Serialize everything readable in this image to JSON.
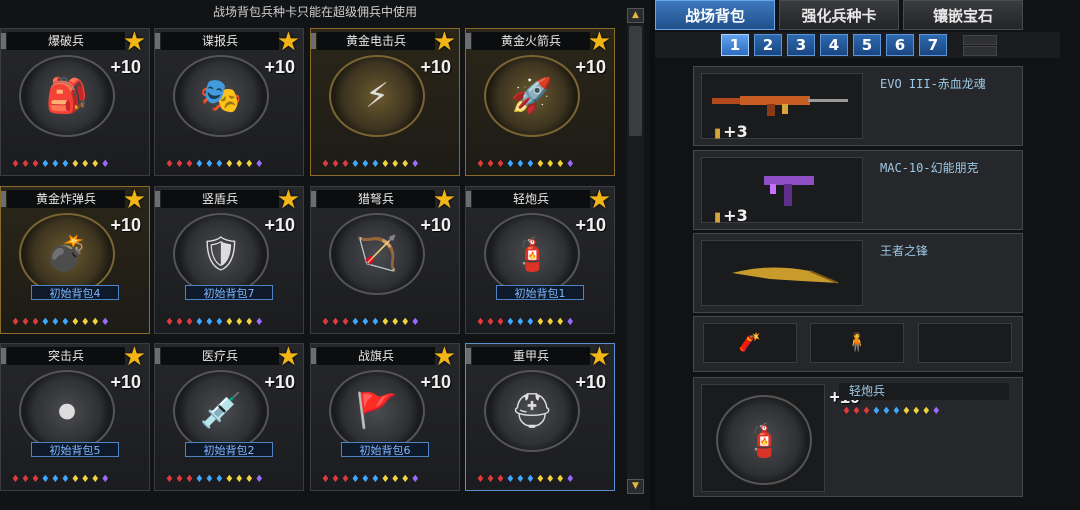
{
  "notice": "战场背包兵种卡只能在超级佣兵中使用",
  "cards": [
    {
      "name": "爆破兵",
      "bonus": "+10",
      "icon": "demolition-kit-icon",
      "glyph": "🎒",
      "gold": false,
      "pack": ""
    },
    {
      "name": "谍报兵",
      "bonus": "+10",
      "icon": "spy-mask-icon",
      "glyph": "🎭",
      "gold": false,
      "pack": ""
    },
    {
      "name": "黄金电击兵",
      "bonus": "+10",
      "icon": "golden-shock-icon",
      "glyph": "⚡",
      "gold": true,
      "pack": ""
    },
    {
      "name": "黄金火箭兵",
      "bonus": "+10",
      "icon": "golden-rocket-icon",
      "glyph": "🚀",
      "gold": true,
      "pack": ""
    },
    {
      "name": "黄金炸弹兵",
      "bonus": "+10",
      "icon": "golden-bomb-icon",
      "glyph": "💣",
      "gold": true,
      "pack": "初始背包4"
    },
    {
      "name": "竖盾兵",
      "bonus": "+10",
      "icon": "riot-shield-icon",
      "glyph": "🛡",
      "gold": false,
      "pack": "初始背包7"
    },
    {
      "name": "猎弩兵",
      "bonus": "+10",
      "icon": "crossbow-icon",
      "glyph": "🏹",
      "gold": false,
      "pack": ""
    },
    {
      "name": "轻炮兵",
      "bonus": "+10",
      "icon": "mortar-icon",
      "glyph": "🧯",
      "gold": false,
      "pack": "初始背包1"
    },
    {
      "name": "突击兵",
      "bonus": "+10",
      "icon": "assault-device-icon",
      "glyph": "⏺",
      "gold": false,
      "pack": "初始背包5"
    },
    {
      "name": "医疗兵",
      "bonus": "+10",
      "icon": "medic-kit-icon",
      "glyph": "💉",
      "gold": false,
      "pack": "初始背包2"
    },
    {
      "name": "战旗兵",
      "bonus": "+10",
      "icon": "war-banner-icon",
      "glyph": "🚩",
      "gold": false,
      "pack": "初始背包6"
    },
    {
      "name": "重甲兵",
      "bonus": "+10",
      "icon": "heavy-armor-helmet-icon",
      "glyph": "⛑",
      "gold": false,
      "pack": "",
      "selected": true
    }
  ],
  "gem_colors": [
    "#e23a3a",
    "#e23a3a",
    "#e23a3a",
    "#3fa9ff",
    "#3fa9ff",
    "#3fa9ff",
    "#f0d23a",
    "#f0d23a",
    "#f0d23a",
    "#9b6bff"
  ],
  "tabs": [
    "战场背包",
    "强化兵种卡",
    "镶嵌宝石"
  ],
  "pages": [
    "1",
    "2",
    "3",
    "4",
    "5",
    "6",
    "7"
  ],
  "slots": [
    {
      "name": "EVO III-赤血龙魂",
      "count": "+3",
      "icon": "assault-rifle-icon"
    },
    {
      "name": "MAC-10-幻能朋克",
      "count": "+3",
      "icon": "smg-icon"
    },
    {
      "name": "王者之锋",
      "count": "",
      "icon": "golden-knife-icon"
    }
  ],
  "mini_slots": [
    "grenade-icon",
    "character-icon",
    ""
  ],
  "current": {
    "name": "轻炮兵",
    "bonus": "+10",
    "icon": "mortar-icon"
  },
  "colors": {
    "accent": "#3e78bd",
    "gold": "#f3b516"
  }
}
